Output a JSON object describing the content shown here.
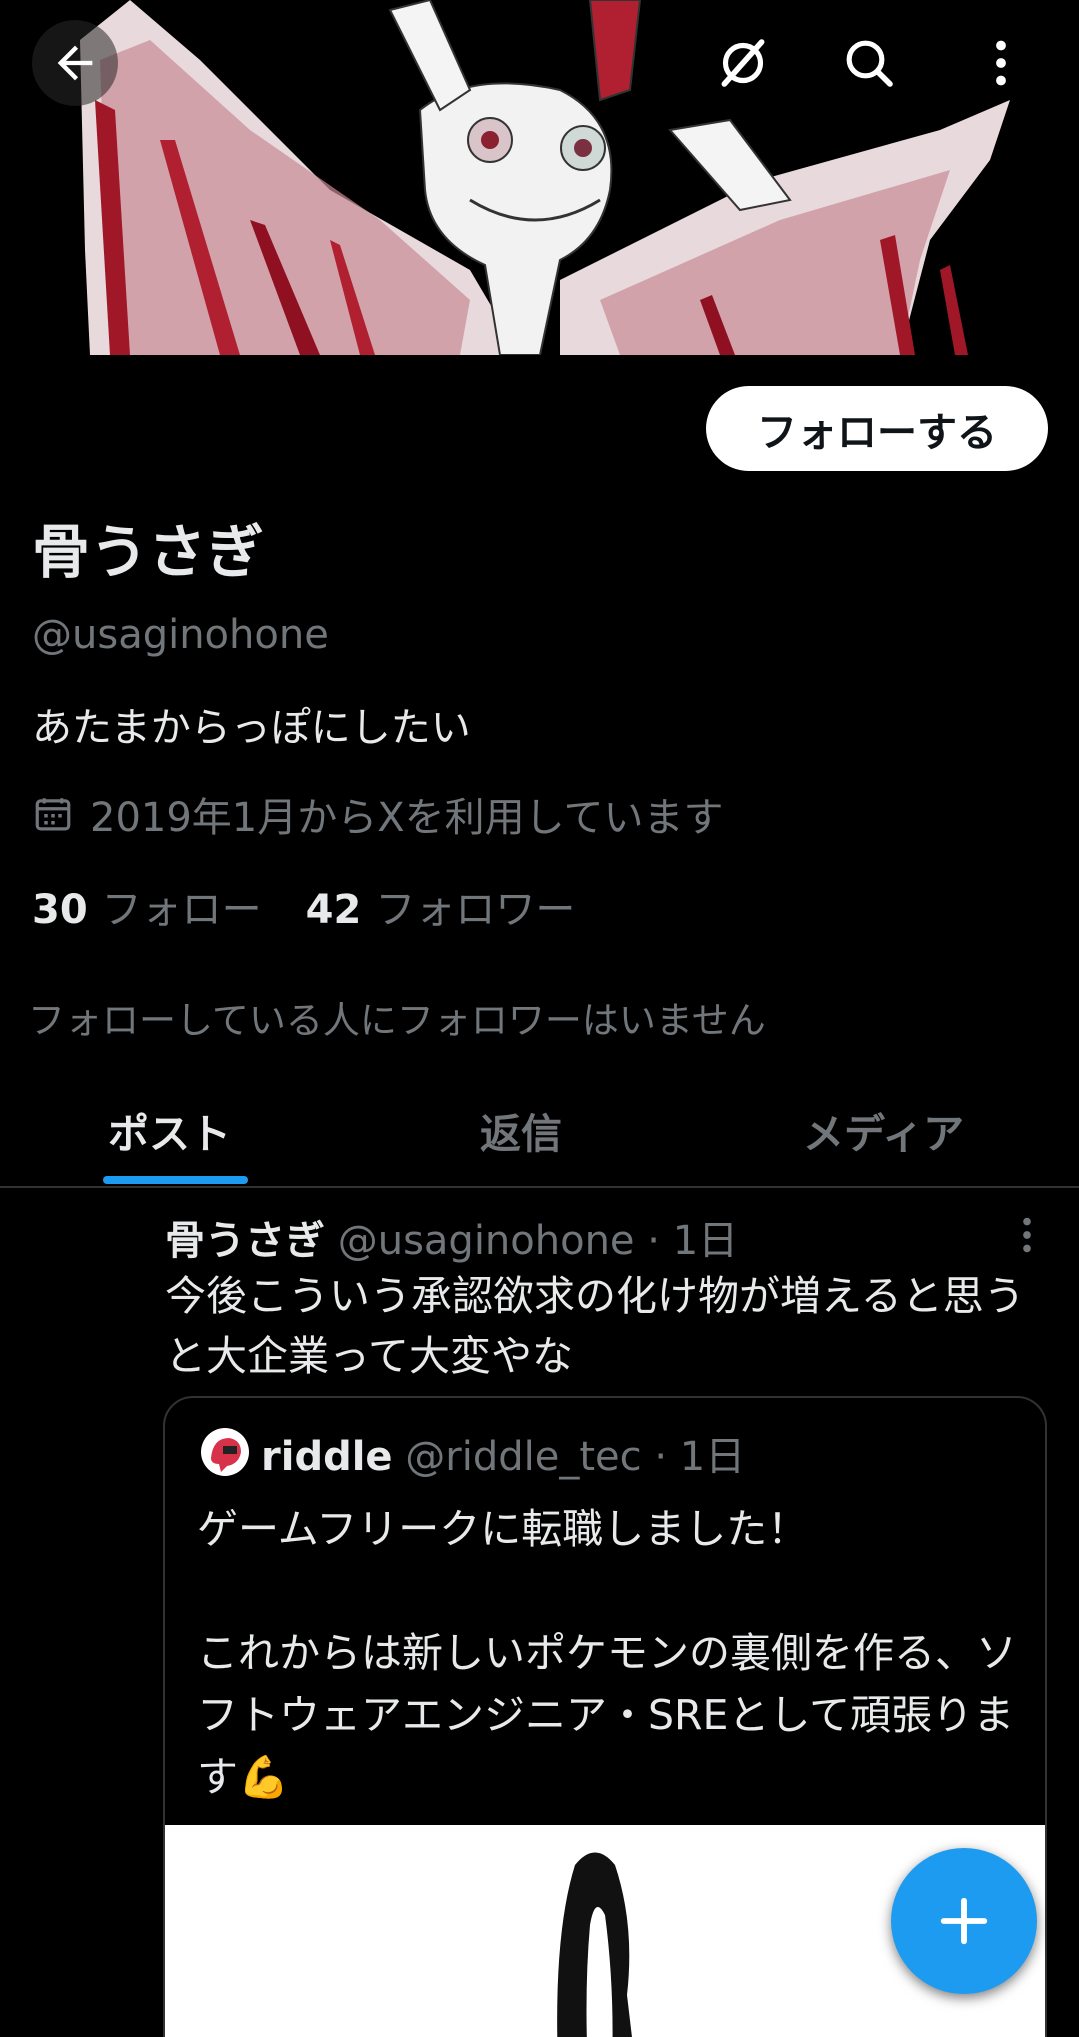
{
  "header": {
    "back_icon": "arrow-left-icon",
    "spark_icon": "grok-icon",
    "search_icon": "search-icon",
    "more_icon": "more-vertical-icon"
  },
  "profile": {
    "follow_label": "フォローする",
    "display_name": "骨うさぎ",
    "handle": "@usaginohone",
    "bio": "あたまからっぽにしたい",
    "joined": "2019年1月からXを利用しています",
    "following_count": "30",
    "following_label": "フォロー",
    "followers_count": "42",
    "followers_label": "フォロワー",
    "no_known_followers": "フォローしている人にフォロワーはいません"
  },
  "tabs": [
    {
      "label": "ポスト",
      "active": true
    },
    {
      "label": "返信",
      "active": false
    },
    {
      "label": "メディア",
      "active": false
    }
  ],
  "post": {
    "name": "骨うさぎ",
    "handle": "@usaginohone",
    "time": "· 1日",
    "text": "今後こういう承認欲求の化け物が増えると思うと大企業って大変やな",
    "quote": {
      "name": "riddle",
      "handle": "@riddle_tec",
      "time": "· 1日",
      "text": "ゲームフリークに転職しました！\n\nこれからは新しいポケモンの裏側を作る、ソフトウェアエンジニア・SREとして頑張ります💪"
    }
  },
  "fab": {
    "icon": "plus-icon"
  },
  "colors": {
    "accent": "#1d9bf0",
    "background": "#000000",
    "text_primary": "#e7e9ea",
    "text_secondary": "#71767b"
  }
}
